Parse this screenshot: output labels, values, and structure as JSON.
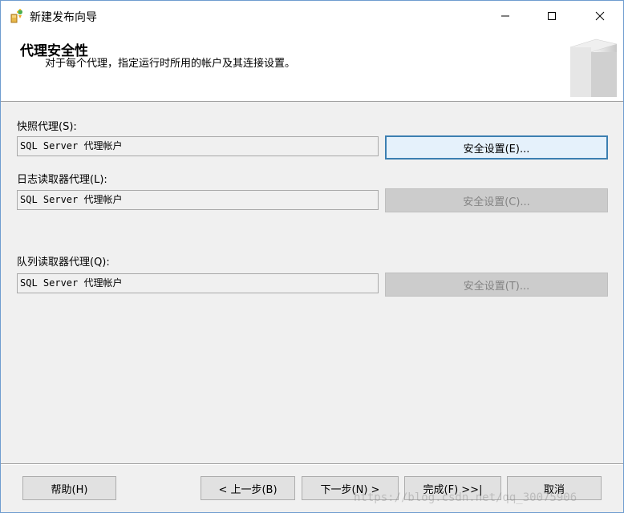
{
  "window": {
    "title": "新建发布向导",
    "controls": {
      "minimize": "—",
      "maximize": "☐",
      "close": "✕"
    }
  },
  "header": {
    "title": "代理安全性",
    "subtitle": "对于每个代理，指定运行时所用的帐户及其连接设置。"
  },
  "agents": [
    {
      "label": "快照代理(S):",
      "account": "SQL Server 代理帐户",
      "button": "安全设置(E)..."
    },
    {
      "label": "日志读取器代理(L):",
      "account": "SQL Server 代理帐户",
      "button": "安全设置(C)..."
    },
    {
      "label": "队列读取器代理(Q):",
      "account": "SQL Server 代理帐户",
      "button": "安全设置(T)..."
    }
  ],
  "footer": {
    "help": "帮助(H)",
    "back": "< 上一步(B)",
    "next": "下一步(N) >",
    "finish": "完成(F) >>|",
    "cancel": "取消"
  },
  "watermark": "https://blog.csdn.net/qq_30075906"
}
